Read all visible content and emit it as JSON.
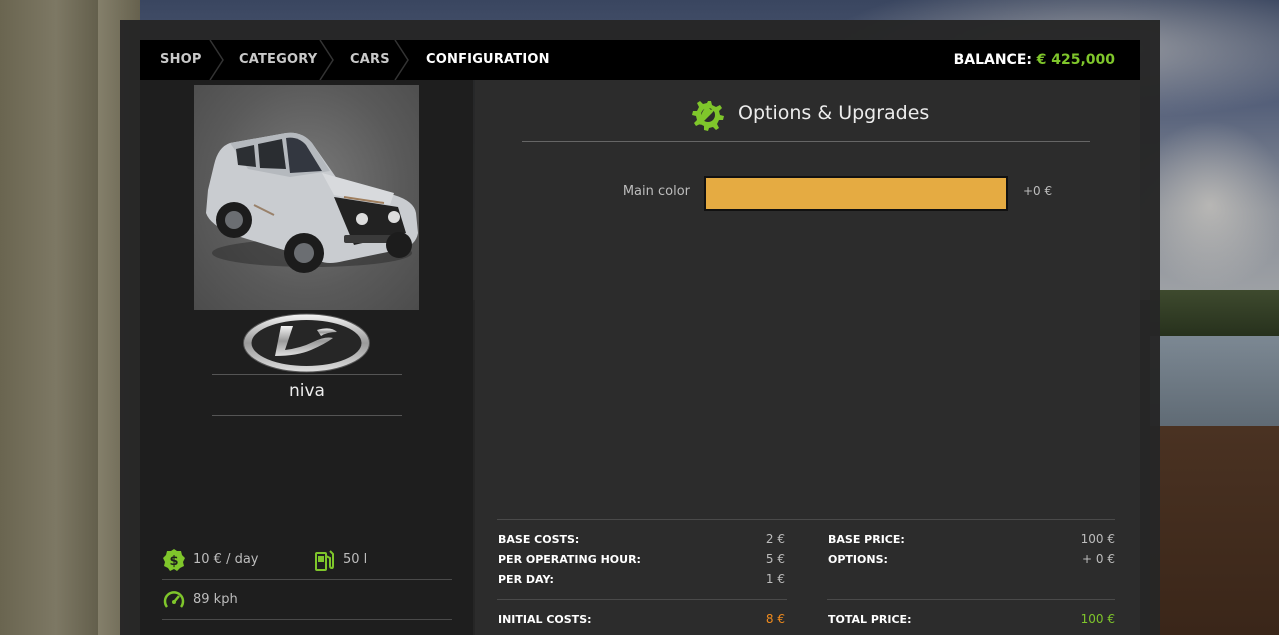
{
  "breadcrumbs": [
    {
      "label": "SHOP"
    },
    {
      "label": "CATEGORY"
    },
    {
      "label": "CARS"
    },
    {
      "label": "CONFIGURATION"
    }
  ],
  "balance": {
    "label": "BALANCE:",
    "value": "€ 425,000"
  },
  "vehicle": {
    "name": "niva",
    "image_icon": "vehicle-image",
    "brand_logo_icon": "brand-logo"
  },
  "specs": {
    "daily_upkeep": {
      "icon": "dollar-coin-icon",
      "text": "10 € / day"
    },
    "fuel_capacity": {
      "icon": "fuel-pump-icon",
      "text": "50 l"
    },
    "max_speed": {
      "icon": "speedometer-icon",
      "text": "89 kph"
    }
  },
  "options": {
    "title": "Options & Upgrades",
    "title_icon": "gear-wrench-icon",
    "items": [
      {
        "label": "Main color",
        "value_color": "#e5ab42",
        "price": "+0 €"
      }
    ]
  },
  "costs": {
    "base_costs": {
      "label": "BASE COSTS:",
      "value": "2 €"
    },
    "per_operating_hour": {
      "label": "PER OPERATING HOUR:",
      "value": "5 €"
    },
    "per_day": {
      "label": "PER DAY:",
      "value": "1 €"
    },
    "initial_costs": {
      "label": "INITIAL COSTS:",
      "value": "8 €"
    },
    "base_price": {
      "label": "BASE PRICE:",
      "value": "100 €"
    },
    "options": {
      "label": "OPTIONS:",
      "value": "+ 0 €"
    },
    "total_price": {
      "label": "TOTAL PRICE:",
      "value": "100 €"
    }
  },
  "colors": {
    "accent_green": "#7fc62b",
    "accent_orange": "#f08b1d",
    "color_swatch": "#e5ab42"
  }
}
